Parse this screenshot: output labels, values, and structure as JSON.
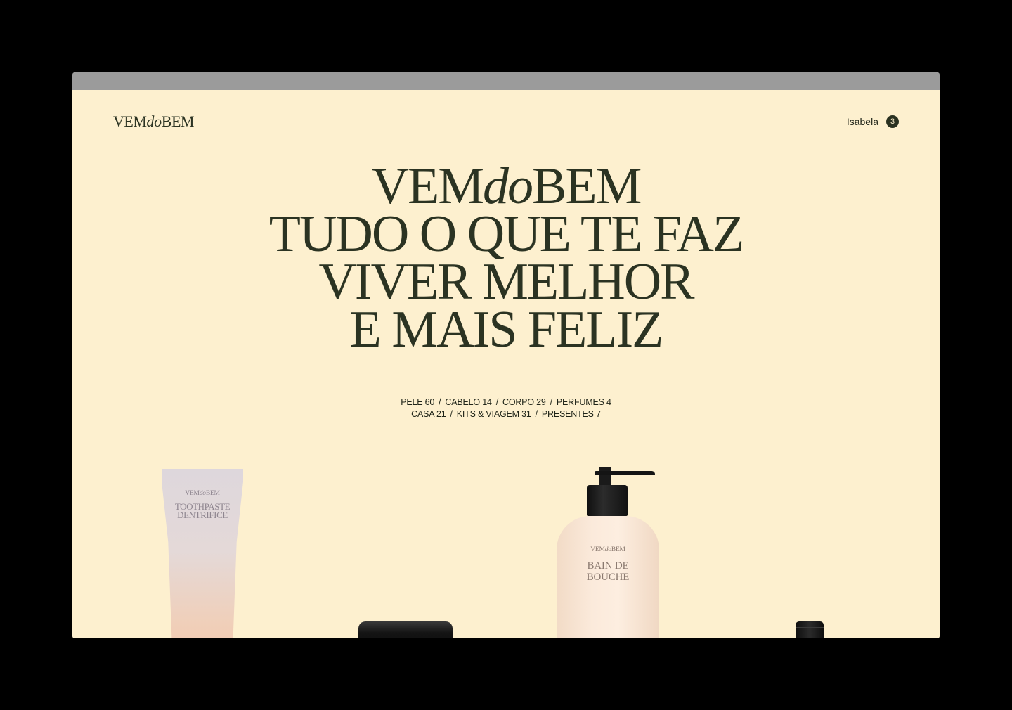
{
  "brand": {
    "logo_main": "VEM",
    "logo_italic": "do",
    "logo_end": "BEM"
  },
  "header": {
    "user_name": "Isabela",
    "cart_count": "3"
  },
  "hero": {
    "line1_a": "VEM",
    "line1_b": "do",
    "line1_c": "BEM",
    "line2": "TUDO O QUE TE FAZ",
    "line3": "VIVER MELHOR",
    "line4": "E MAIS FELIZ"
  },
  "categories": [
    {
      "label": "PELE 60"
    },
    {
      "label": "CABELO 14"
    },
    {
      "label": "CORPO 29"
    },
    {
      "label": "PERFUMES 4"
    },
    {
      "label": "CASA 21"
    },
    {
      "label": "KITS & VIAGEM 31"
    },
    {
      "label": "PRESENTES 7"
    }
  ],
  "separator": "/",
  "products": {
    "tube": {
      "brand_a": "VEM",
      "brand_b": "do",
      "brand_c": "BEM",
      "name_line1": "TOOTHPASTE",
      "name_line2": "DENTRIFICE"
    },
    "pump": {
      "brand_a": "VEM",
      "brand_b": "do",
      "brand_c": "BEM",
      "name_line1": "BAIN DE",
      "name_line2": "BOUCHE"
    }
  },
  "colors": {
    "page_background": "#fdf0cf",
    "text_primary": "#2b3322",
    "badge_background": "#2a3120",
    "browser_bar": "#9b9b9b"
  }
}
